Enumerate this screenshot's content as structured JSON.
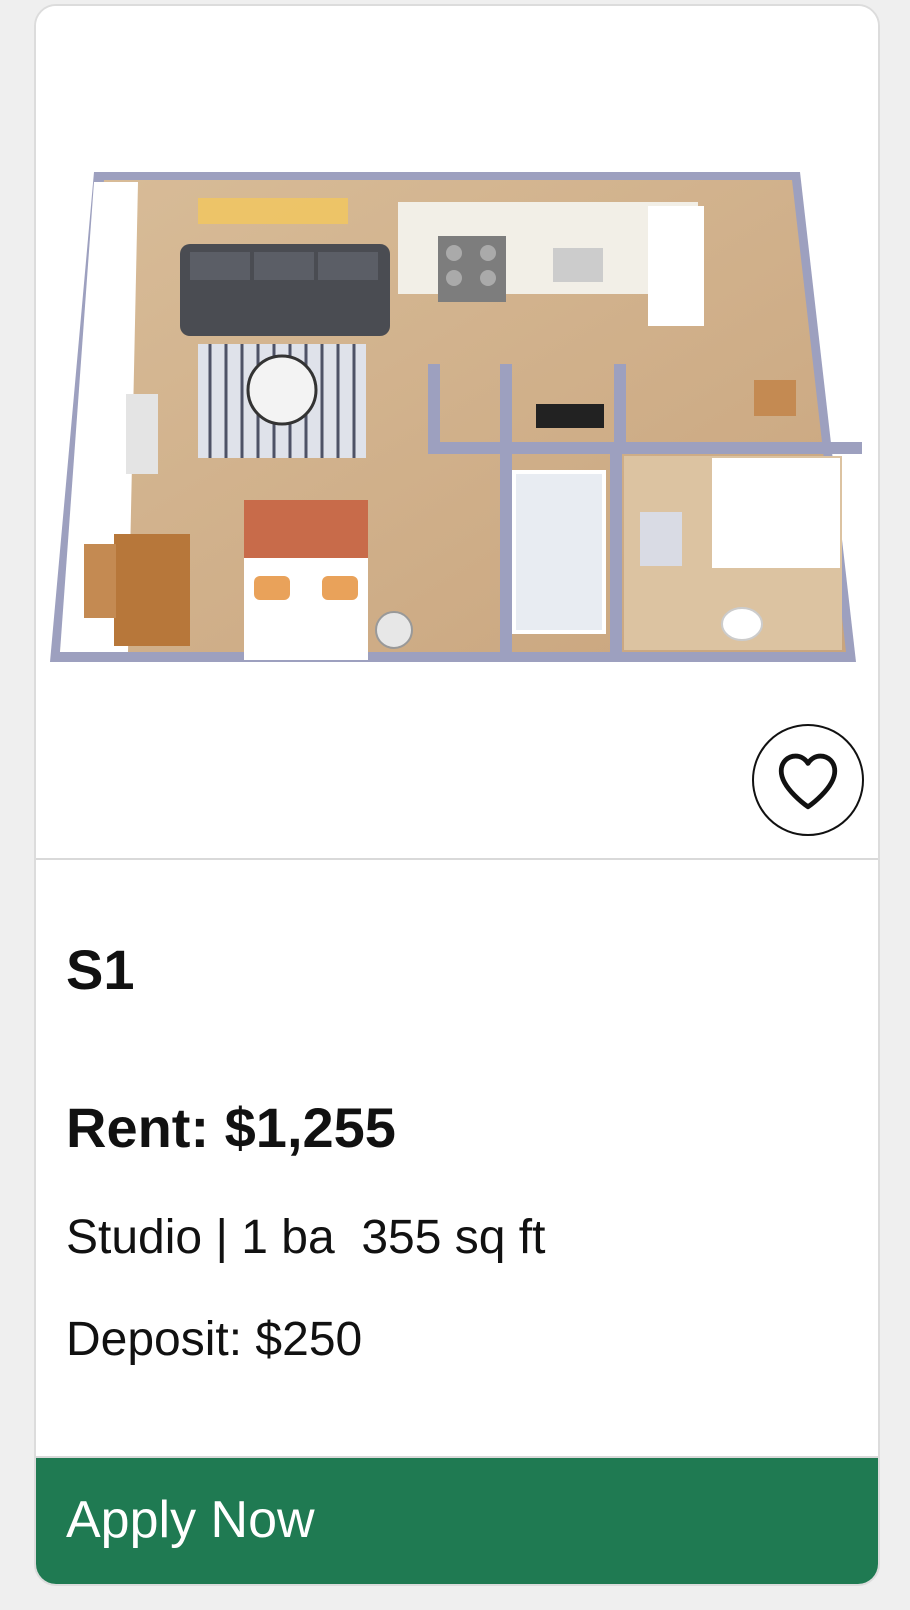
{
  "listing": {
    "image_alt": "Studio floor plan",
    "favorite_icon": "heart-icon",
    "plan_name": "S1",
    "rent": "Rent: $1,255",
    "details": "Studio | 1 ba  355 sq ft",
    "deposit": "Deposit: $250",
    "apply_label": "Apply Now"
  },
  "colors": {
    "apply_button": "#1f7a52",
    "card_background": "#ffffff",
    "page_background": "#efefef"
  }
}
